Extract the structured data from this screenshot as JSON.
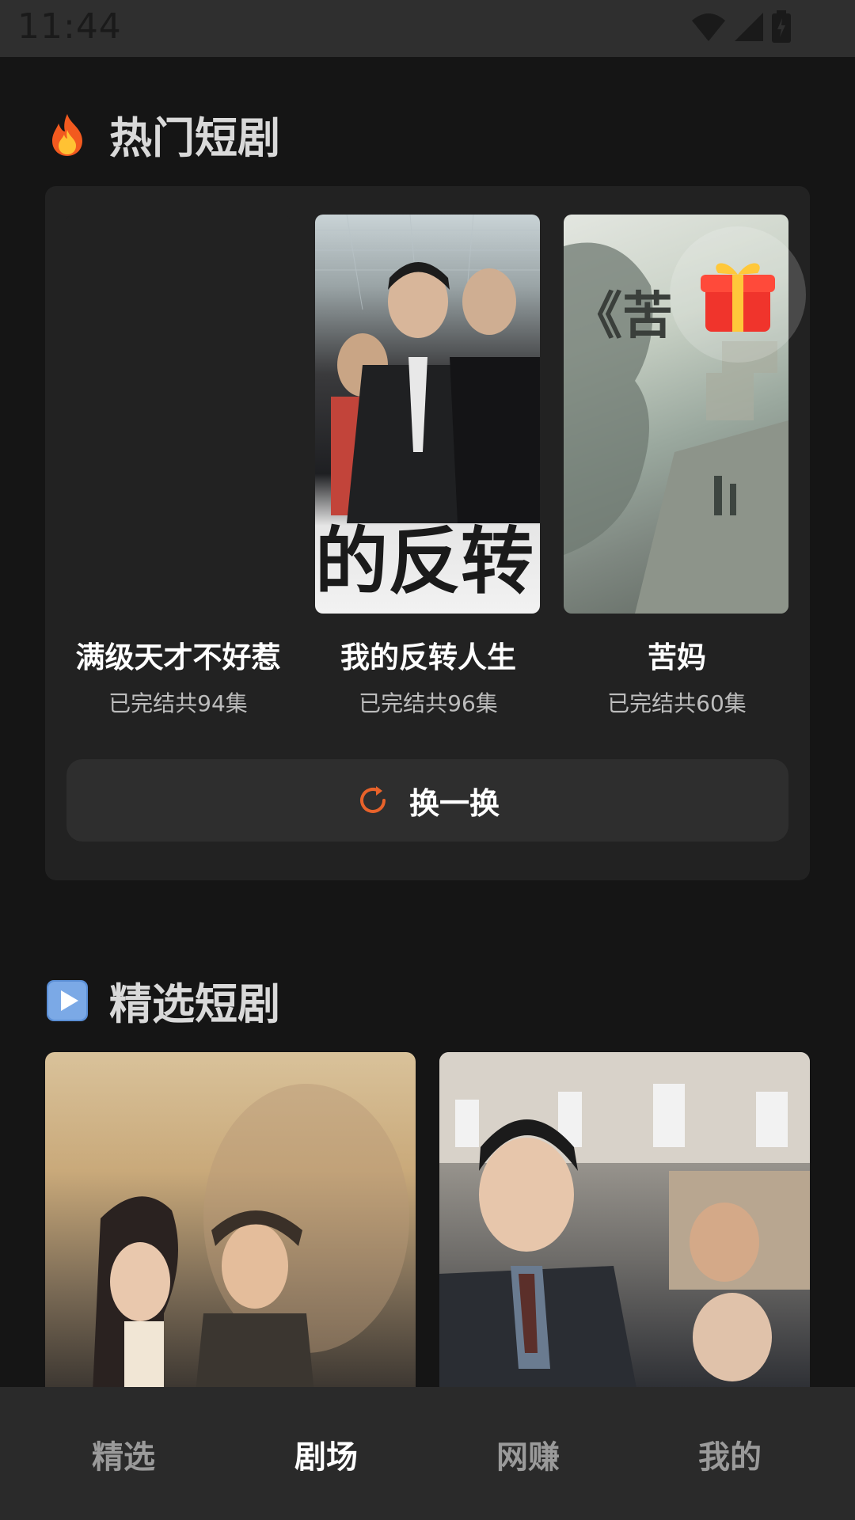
{
  "status_bar": {
    "time": "11:44"
  },
  "hot_section": {
    "title": "热门短剧",
    "icon": "fire-icon",
    "items": [
      {
        "title": "满级天才不好惹",
        "subtitle": "已完结共94集"
      },
      {
        "title": "我的反转人生",
        "subtitle": "已完结共96集"
      },
      {
        "title": "苦妈",
        "subtitle": "已完结共60集"
      }
    ],
    "refresh_label": "换一换",
    "refresh_icon": "refresh-icon",
    "accent_color": "#E8622A"
  },
  "featured_section": {
    "title": "精选短剧",
    "icon": "play-icon"
  },
  "bottom_nav": {
    "items": [
      {
        "label": "精选",
        "active": false
      },
      {
        "label": "剧场",
        "active": true
      },
      {
        "label": "网赚",
        "active": false
      },
      {
        "label": "我的",
        "active": false
      }
    ]
  }
}
